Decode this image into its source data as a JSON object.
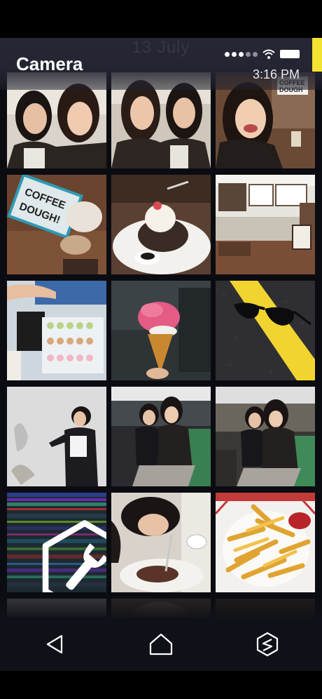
{
  "header": {
    "title": "Camera",
    "date_ghost": "13 July",
    "time": "3:16 PM"
  },
  "status_icons": [
    "signal-dots-icon",
    "wifi-icon",
    "battery-icon"
  ],
  "colors": {
    "accent": "#f2e331",
    "header_bg": "#262734",
    "nav_bg": "#101118"
  },
  "gallery": {
    "items": [
      {
        "name": "photo-two-women-selfie-1",
        "kind": "photo"
      },
      {
        "name": "photo-two-women-selfie-2",
        "kind": "photo"
      },
      {
        "name": "photo-woman-selfie-coffee-dough",
        "kind": "photo"
      },
      {
        "name": "photo-coffee-dough-lightbox",
        "kind": "photo"
      },
      {
        "name": "photo-pancake-dessert",
        "kind": "photo"
      },
      {
        "name": "photo-cafe-counter",
        "kind": "photo"
      },
      {
        "name": "photo-macaron-display",
        "kind": "photo"
      },
      {
        "name": "photo-ice-cream-cone",
        "kind": "photo"
      },
      {
        "name": "photo-sunglasses-on-road",
        "kind": "photo"
      },
      {
        "name": "photo-woman-white-wall",
        "kind": "photo"
      },
      {
        "name": "photo-two-women-sitting-1",
        "kind": "photo"
      },
      {
        "name": "photo-two-women-sitting-2",
        "kind": "photo"
      },
      {
        "name": "glitch-tile-with-wrench",
        "kind": "tool",
        "icon": "wrench-hexagon-icon"
      },
      {
        "name": "photo-woman-eating-dessert",
        "kind": "photo"
      },
      {
        "name": "photo-french-fries",
        "kind": "photo"
      }
    ]
  },
  "nav": {
    "buttons": [
      "back-icon",
      "home-icon",
      "hex-s-icon"
    ]
  }
}
